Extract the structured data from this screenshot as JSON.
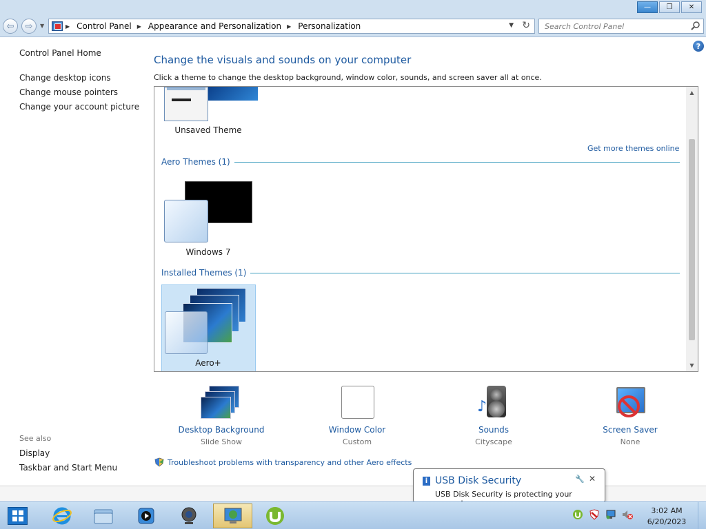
{
  "window": {
    "minimize": "—",
    "restore": "❐",
    "close": "✕"
  },
  "address": {
    "breadcrumbs": [
      "Control Panel",
      "Appearance and Personalization",
      "Personalization"
    ],
    "search_placeholder": "Search Control Panel"
  },
  "sidebar": {
    "home": "Control Panel Home",
    "links": [
      "Change desktop icons",
      "Change mouse pointers",
      "Change your account picture"
    ],
    "see_also_label": "See also",
    "see_also": [
      "Display",
      "Taskbar and Start Menu"
    ]
  },
  "main": {
    "title": "Change the visuals and sounds on your computer",
    "subtitle": "Click a theme to change the desktop background, window color, sounds, and screen saver all at once.",
    "help": "?",
    "get_more": "Get more themes online",
    "my_themes": [
      {
        "name": "Unsaved Theme"
      }
    ],
    "groups": [
      {
        "label": "Aero Themes (1)",
        "themes": [
          {
            "name": "Windows 7"
          }
        ]
      },
      {
        "label": "Installed Themes (1)",
        "themes": [
          {
            "name": "Aero+",
            "selected": true
          }
        ]
      }
    ],
    "tools": [
      {
        "title": "Desktop Background",
        "value": "Slide Show"
      },
      {
        "title": "Window Color",
        "value": "Custom"
      },
      {
        "title": "Sounds",
        "value": "Cityscape"
      },
      {
        "title": "Screen Saver",
        "value": "None"
      }
    ],
    "troubleshoot": "Troubleshoot problems with transparency and other Aero effects"
  },
  "notification": {
    "title": "USB Disk Security",
    "message": "USB Disk Security is protecting your computer"
  },
  "taskbar": {
    "time": "3:02 AM",
    "date": "6/20/2023"
  },
  "colors": {
    "link": "#1e5aa0",
    "selection": "#cce4f7",
    "taskbar": "#b9d4ee"
  }
}
